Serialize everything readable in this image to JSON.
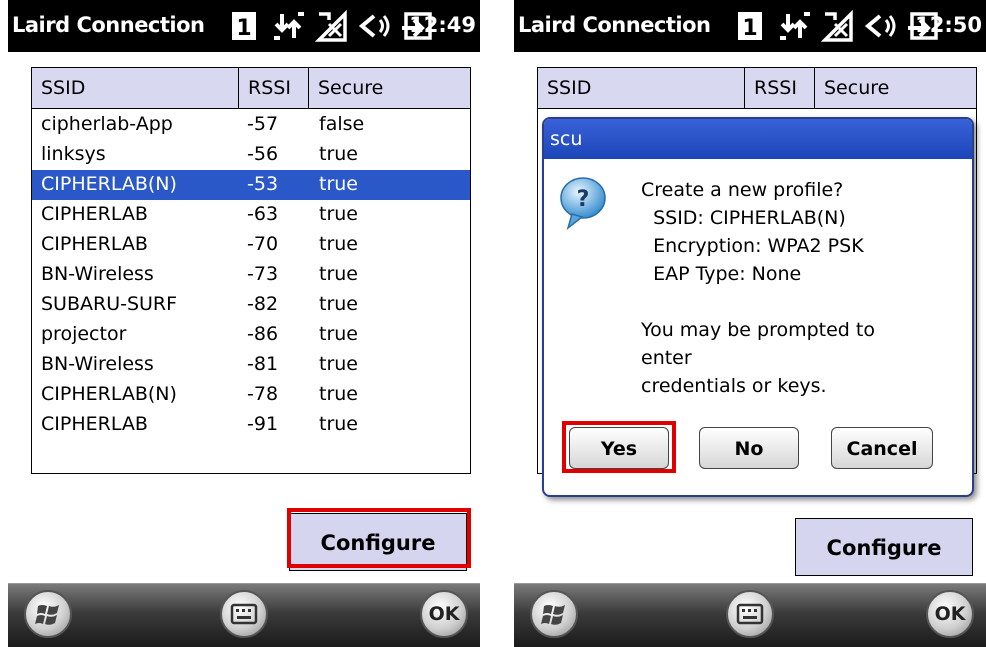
{
  "status_bar": {
    "app_title": "Laird Connection",
    "left_time": "12:49",
    "right_time": "12:50",
    "icons": [
      "sim-1-icon",
      "data-transfer-icon",
      "no-signal-icon",
      "volume-icon",
      "battery-charging-icon"
    ]
  },
  "left_panel": {
    "columns": [
      "SSID",
      "RSSI",
      "Secure"
    ],
    "rows": [
      {
        "ssid": "cipherlab-App",
        "rssi": "-57",
        "secure": "false"
      },
      {
        "ssid": "linksys",
        "rssi": "-56",
        "secure": "true"
      },
      {
        "ssid": "CIPHERLAB(N)",
        "rssi": "-53",
        "secure": "true",
        "selected": true
      },
      {
        "ssid": "CIPHERLAB",
        "rssi": "-63",
        "secure": "true"
      },
      {
        "ssid": "CIPHERLAB",
        "rssi": "-70",
        "secure": "true"
      },
      {
        "ssid": "BN-Wireless",
        "rssi": "-73",
        "secure": "true"
      },
      {
        "ssid": "SUBARU-SURF",
        "rssi": "-82",
        "secure": "true"
      },
      {
        "ssid": "projector",
        "rssi": "-86",
        "secure": "true"
      },
      {
        "ssid": "BN-Wireless",
        "rssi": "-81",
        "secure": "true"
      },
      {
        "ssid": "CIPHERLAB(N)",
        "rssi": "-78",
        "secure": "true"
      },
      {
        "ssid": "CIPHERLAB",
        "rssi": "-91",
        "secure": "true"
      }
    ],
    "configure_label": "Configure"
  },
  "right_panel": {
    "columns": [
      "SSID",
      "RSSI",
      "Secure"
    ],
    "configure_label": "Configure",
    "dialog": {
      "title": "scu",
      "message": "Create a new profile?\n  SSID: CIPHERLAB(N)\n  Encryption: WPA2 PSK\n  EAP Type: None\n\nYou may be prompted to\nenter\ncredentials or keys.",
      "buttons": {
        "yes": "Yes",
        "no": "No",
        "cancel": "Cancel"
      }
    }
  },
  "bottom_bar": {
    "ok_label": "OK"
  },
  "colors": {
    "selection": "#2b58c8",
    "header_bg": "#d8d8f0",
    "highlight": "#e00000",
    "dialog_title": "#1c45b8"
  }
}
